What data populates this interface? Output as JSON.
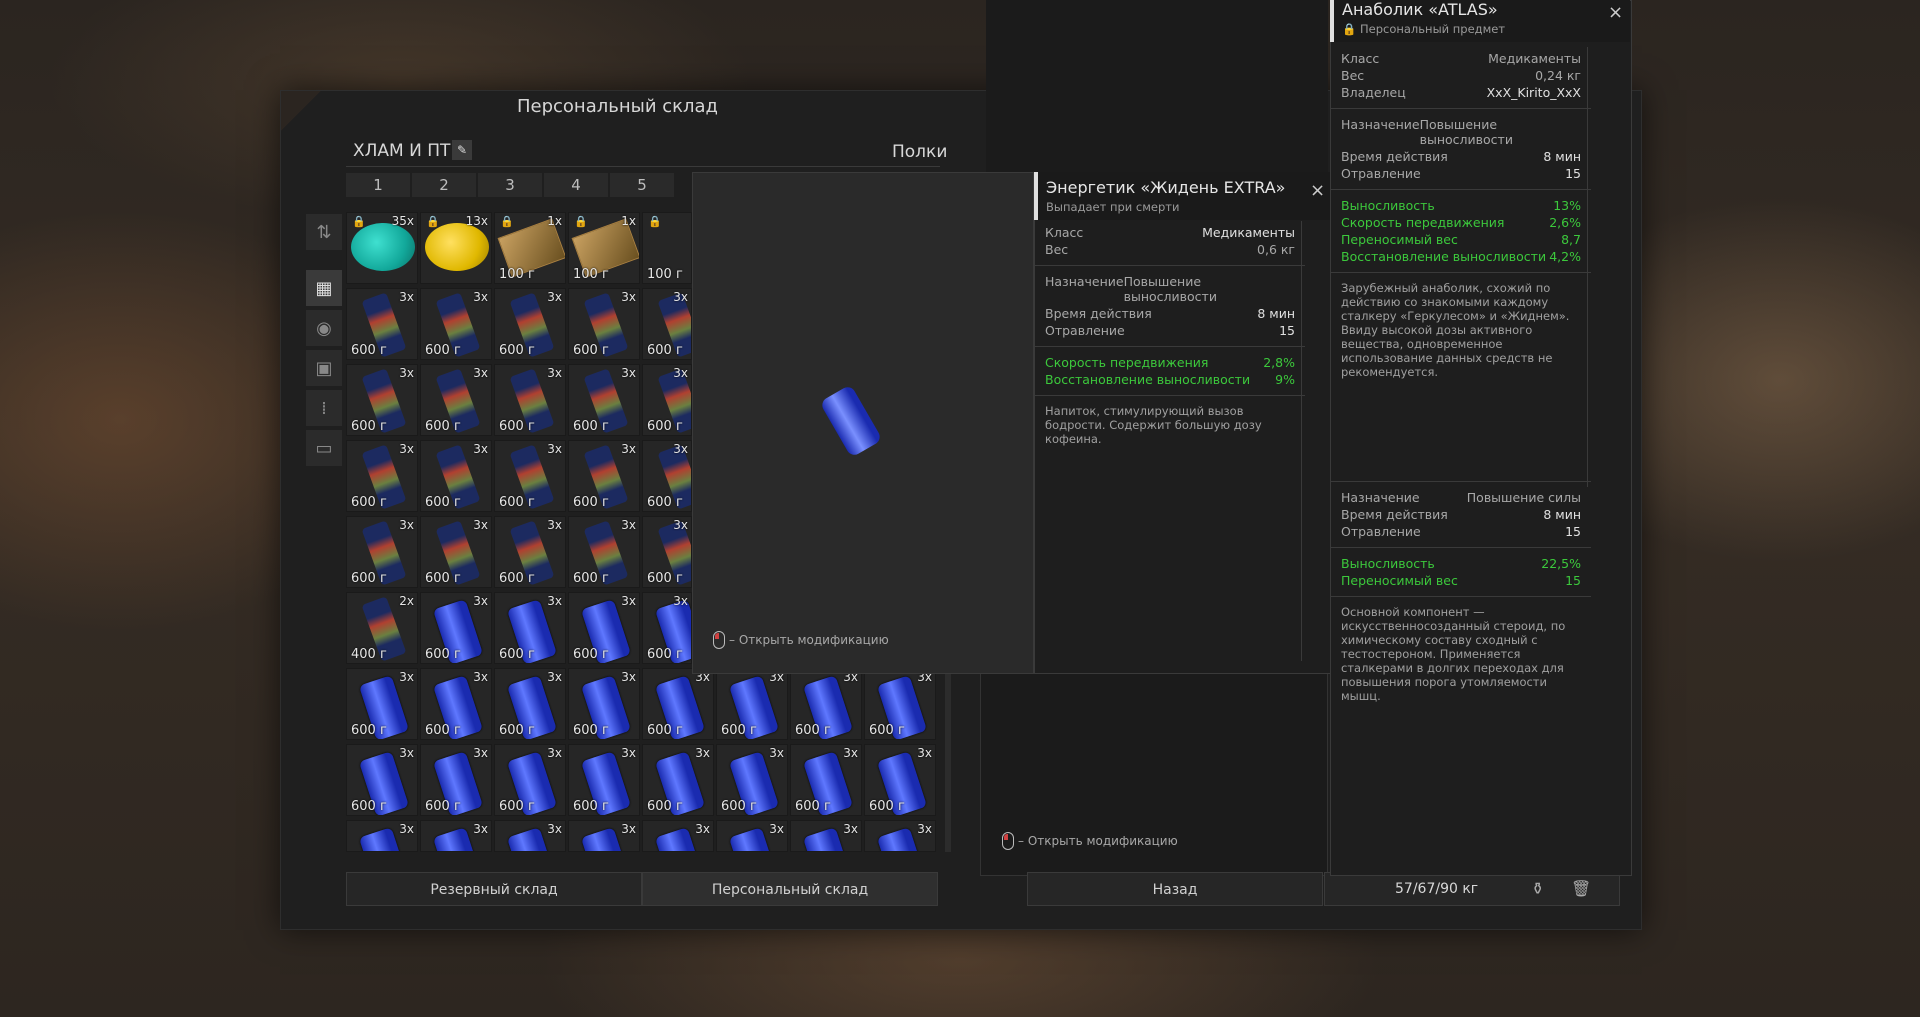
{
  "main": {
    "title": "Персональный склад",
    "section_name": "ХЛАМ И ПТ!",
    "shelves_label": "Полки",
    "columns": [
      "1",
      "2",
      "3",
      "4",
      "5"
    ],
    "bottom_tabs": [
      "Резервный склад",
      "Персональный склад"
    ],
    "back_label": "Назад",
    "weight_readout": "57/67/90 кг"
  },
  "grid": {
    "row0": [
      {
        "count": "35x",
        "weight": ""
      },
      {
        "count": "13x",
        "weight": ""
      },
      {
        "count": "1x",
        "weight": "100 г"
      },
      {
        "count": "1x",
        "weight": "100 г"
      },
      {
        "count": "",
        "weight": "100 г"
      }
    ],
    "bottle_count": "3x",
    "bottle_weight": "600 г",
    "bottle_last_count": "2x",
    "bottle_last_weight": "400 г",
    "can_count": "3x",
    "can_weight": "600 г"
  },
  "energy_popup": {
    "title": "Энергетик «Жидень EXTRA»",
    "subtitle": "Выпадает при смерти",
    "class_label": "Класс",
    "class_value": "Медикаменты",
    "weight_label": "Вес",
    "weight_value": "0,6 кг",
    "purpose_label": "Назначение",
    "purpose_value": "Повышение выносливости",
    "duration_label": "Время действия",
    "duration_value": "8 мин",
    "poison_label": "Отравление",
    "poison_value": "15",
    "stat1_label": "Скорость передвижения",
    "stat1_value": "2,8%",
    "stat2_label": "Восстановление выносливости",
    "stat2_value": "9%",
    "description": "Напиток, стимулирующий вызов бодрости. Содержит большую дозу кофеина.",
    "hint": "– Открыть модификацию"
  },
  "container_hint": "– Открыть модификацию",
  "atlas_popup": {
    "title": "Анаболик «ATLAS»",
    "subtitle": "Персональный предмет",
    "class_label": "Класс",
    "class_value": "Медикаменты",
    "weight_label": "Вес",
    "weight_value": "0,24 кг",
    "owner_label": "Владелец",
    "owner_value": "XxX_Kirito_XxX",
    "purpose_label": "Назначение",
    "purpose_value": "Повышение выносливости",
    "duration_label": "Время действия",
    "duration_value": "8 мин",
    "poison_label": "Отравление",
    "poison_value": "15",
    "stat1_label": "Выносливость",
    "stat1_value": "13%",
    "stat2_label": "Скорость передвижения",
    "stat2_value": "2,6%",
    "stat3_label": "Переносимый вес",
    "stat3_value": "8,7",
    "stat4_label": "Восстановление выносливости",
    "stat4_value": "4,2%",
    "description": "Зарубежный анаболик, схожий по действию со знакомыми каждому сталкеру «Геркулесом» и «Жиднем». Ввиду высокой дозы активного вещества, одновременное использование данных средств не рекомендуется.",
    "sec2_purpose_label": "Назначение",
    "sec2_purpose_value": "Повышение силы",
    "sec2_duration_label": "Время действия",
    "sec2_duration_value": "8 мин",
    "sec2_poison_label": "Отравление",
    "sec2_poison_value": "15",
    "sec2_stat1_label": "Выносливость",
    "sec2_stat1_value": "22,5%",
    "sec2_stat2_label": "Переносимый вес",
    "sec2_stat2_value": "15",
    "sec2_description": "Основной компонент — искусственносозданный стероид, по химическому составу сходный с тестостероном. Применяется сталкерами в долгих переходах для повышения порога утомляемости мышц."
  }
}
